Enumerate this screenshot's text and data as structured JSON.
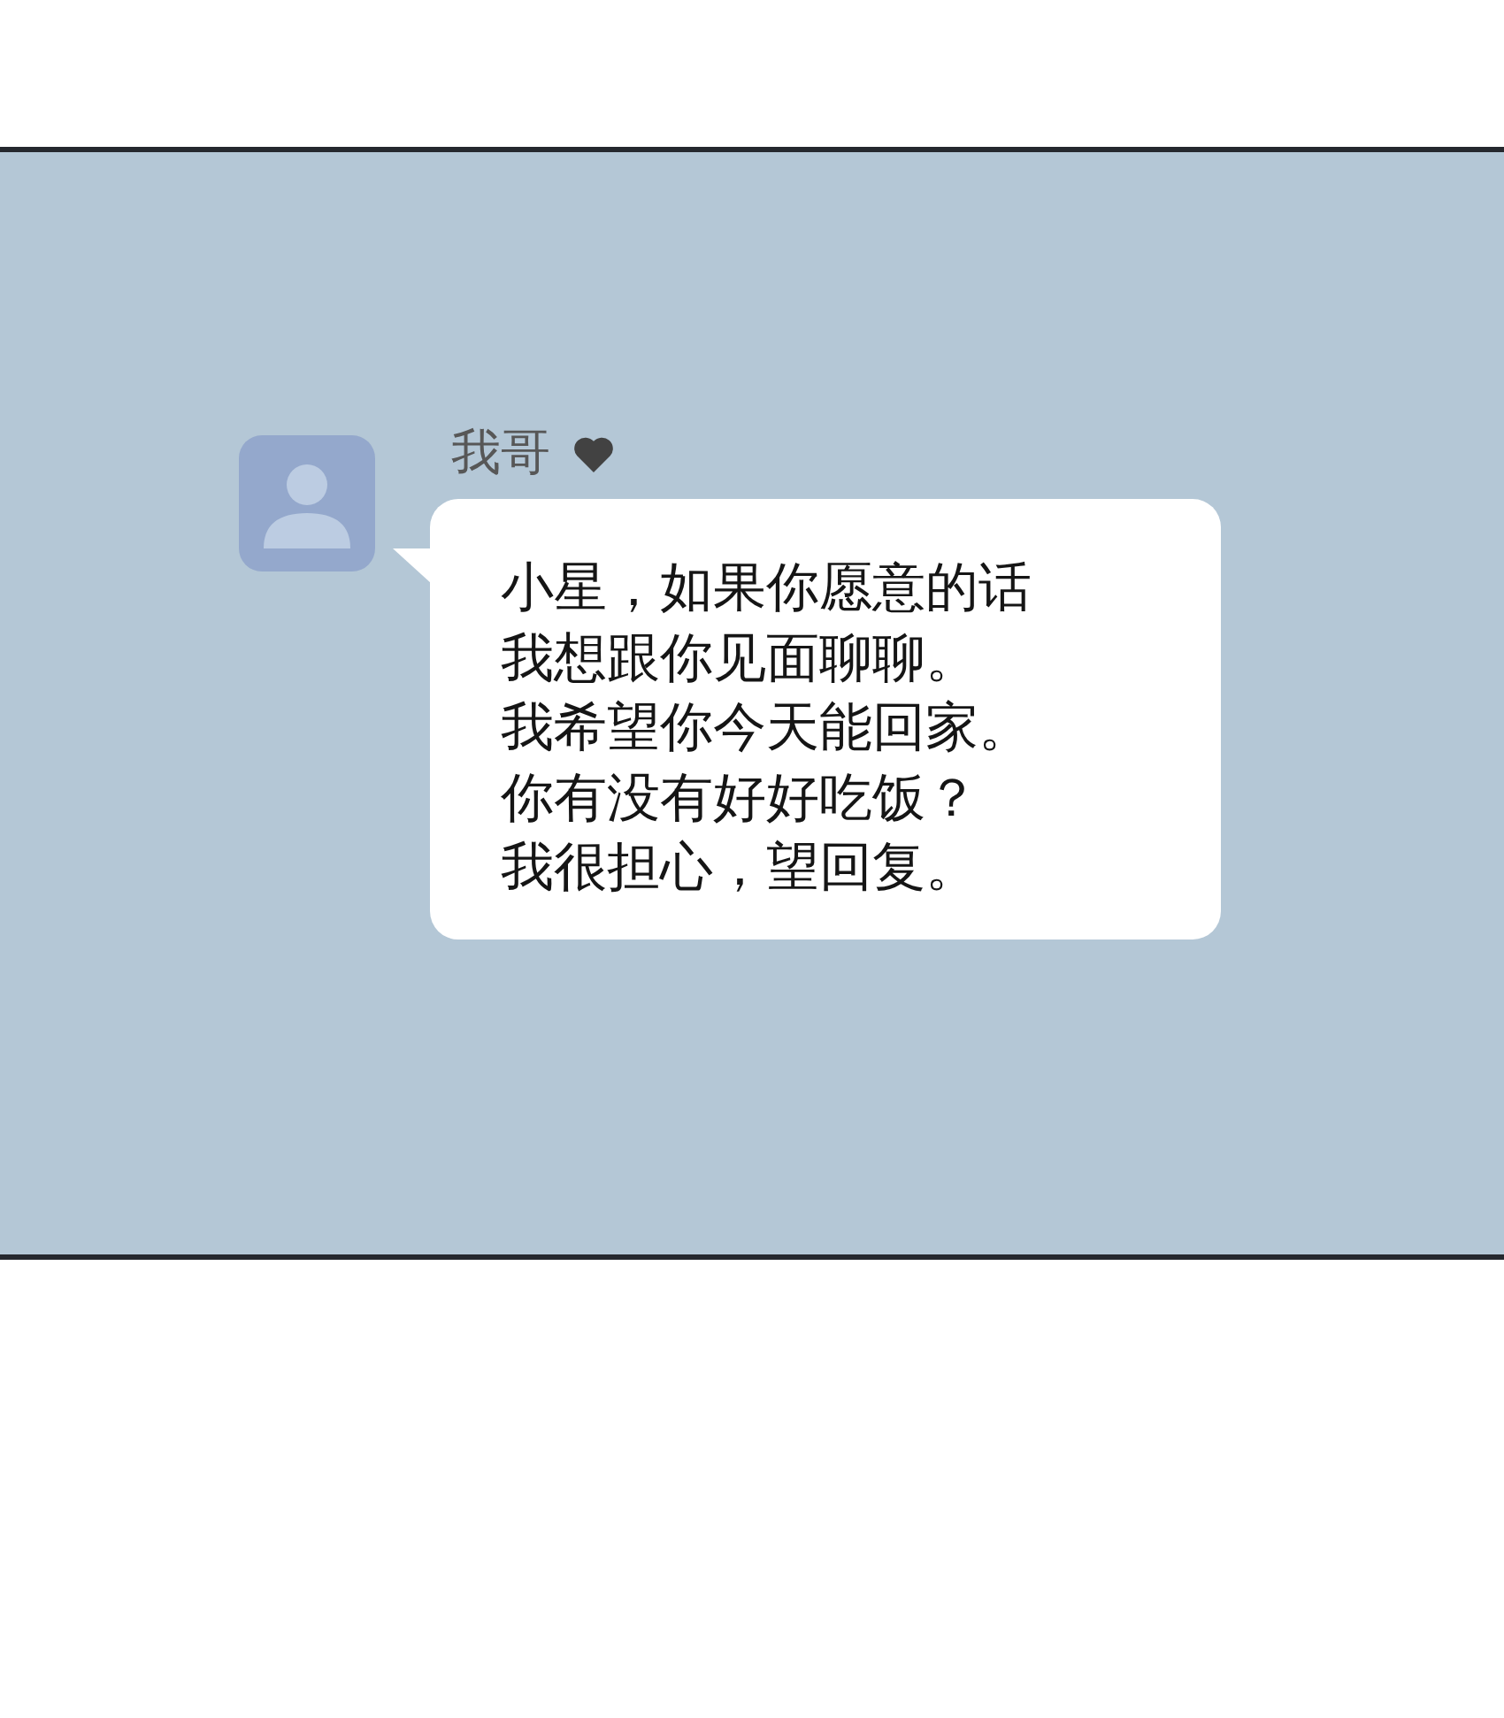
{
  "chat": {
    "sender": {
      "name": "我哥"
    },
    "message": {
      "lines": [
        "小星，如果你愿意的话",
        "我想跟你见面聊聊。",
        "我希望你今天能回家。",
        "你有没有好好吃饭？",
        "我很担心，望回复。"
      ]
    }
  }
}
